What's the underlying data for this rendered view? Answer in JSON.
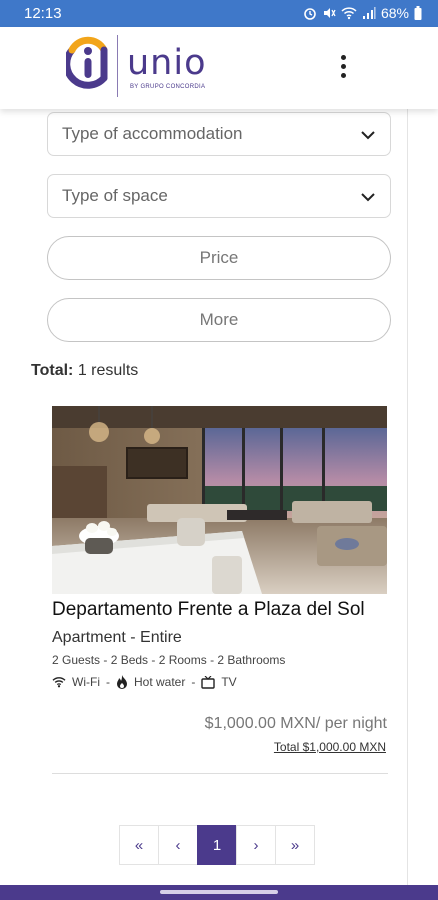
{
  "status_bar": {
    "time": "12:13",
    "battery": "68%"
  },
  "header": {
    "brand_name": "unio",
    "brand_sub": "BY GRUPO CONCORDIA",
    "colors": {
      "brand": "#4b3a8c",
      "logo_accent": "#f2a51a",
      "status_bar": "#3f78c9"
    }
  },
  "filters": {
    "accommodation_placeholder": "Type of accommodation",
    "space_placeholder": "Type of space",
    "price_label": "Price",
    "more_label": "More"
  },
  "results": {
    "total_label": "Total:",
    "total_text": "1 results"
  },
  "listing": {
    "title": "Departamento Frente a Plaza del Sol",
    "subtype": "Apartment - Entire",
    "features": "2  Guests - 2  Beds - 2  Rooms - 2  Bathrooms",
    "amenities": [
      {
        "icon": "wifi-icon",
        "label": "Wi-Fi"
      },
      {
        "icon": "flame-icon",
        "label": "Hot water"
      },
      {
        "icon": "tv-icon",
        "label": "TV"
      }
    ],
    "price_per_night": "$1,000.00 MXN/ per night",
    "total_price": "Total $1,000.00 MXN"
  },
  "pagination": {
    "first": "«",
    "prev": "‹",
    "current": "1",
    "next": "›",
    "last": "»"
  }
}
